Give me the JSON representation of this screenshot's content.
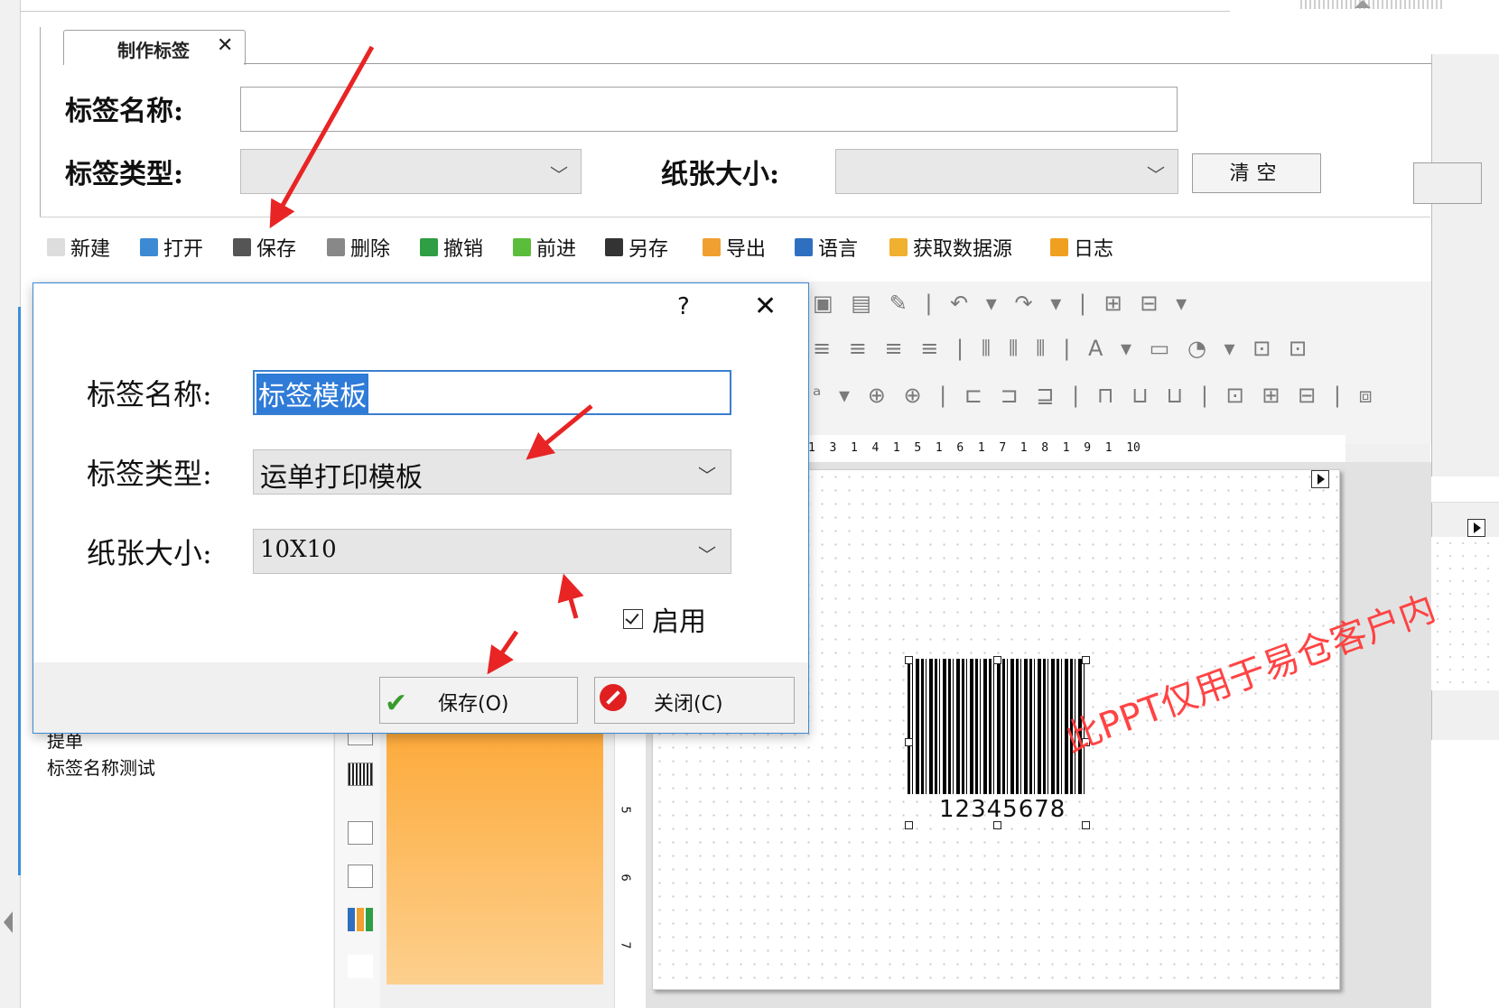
{
  "tab": {
    "label": "制作标签",
    "close": "✕"
  },
  "form": {
    "name_label": "标签名称:",
    "name_value": "",
    "type_label": "标签类型:",
    "type_value": "",
    "paper_label": "纸张大小:",
    "paper_value": "",
    "clear_label": "清空"
  },
  "toolbar": [
    {
      "label": "新建",
      "icon": "new-file-icon",
      "color": "#dddddd"
    },
    {
      "label": "打开",
      "icon": "open-folder-icon",
      "color": "#3c8ad4"
    },
    {
      "label": "保存",
      "icon": "save-icon",
      "color": "#555555"
    },
    {
      "label": "删除",
      "icon": "delete-icon",
      "color": "#888888"
    },
    {
      "label": "撤销",
      "icon": "undo-icon",
      "color": "#2f9e44"
    },
    {
      "label": "前进",
      "icon": "forward-icon",
      "color": "#5abd3b"
    },
    {
      "label": "另存",
      "icon": "save-as-icon",
      "color": "#333333"
    },
    {
      "label": "导出",
      "icon": "export-icon",
      "color": "#f0a030"
    },
    {
      "label": "语言",
      "icon": "language-icon",
      "color": "#2f6fc0"
    },
    {
      "label": "获取数据源",
      "icon": "datasource-icon",
      "color": "#f0b030"
    },
    {
      "label": "日志",
      "icon": "log-icon",
      "color": "#f0a020"
    }
  ],
  "dialog": {
    "help": "?",
    "close": "✕",
    "name_label": "标签名称:",
    "name_value": "标签模板",
    "type_label": "标签类型:",
    "type_value": "运单打印模板",
    "paper_label": "纸张大小:",
    "paper_value": "10X10",
    "enable_label": "启用",
    "enable_checked": true,
    "save_label": "保存(O)",
    "close_label": "关闭(C)"
  },
  "list": {
    "items": [
      "提单",
      "标签名称测试"
    ]
  },
  "ruler": {
    "h_text": "1  3  1  4  1  5  1  6  1  7  1  8  1  9  1  10"
  },
  "barcode": {
    "number": "12345678"
  },
  "watermark": "此PPT仅用于易仓客户内",
  "colors": {
    "accent": "#3c8ad4",
    "arrow": "#e82424",
    "orange": "#fdb04a"
  }
}
